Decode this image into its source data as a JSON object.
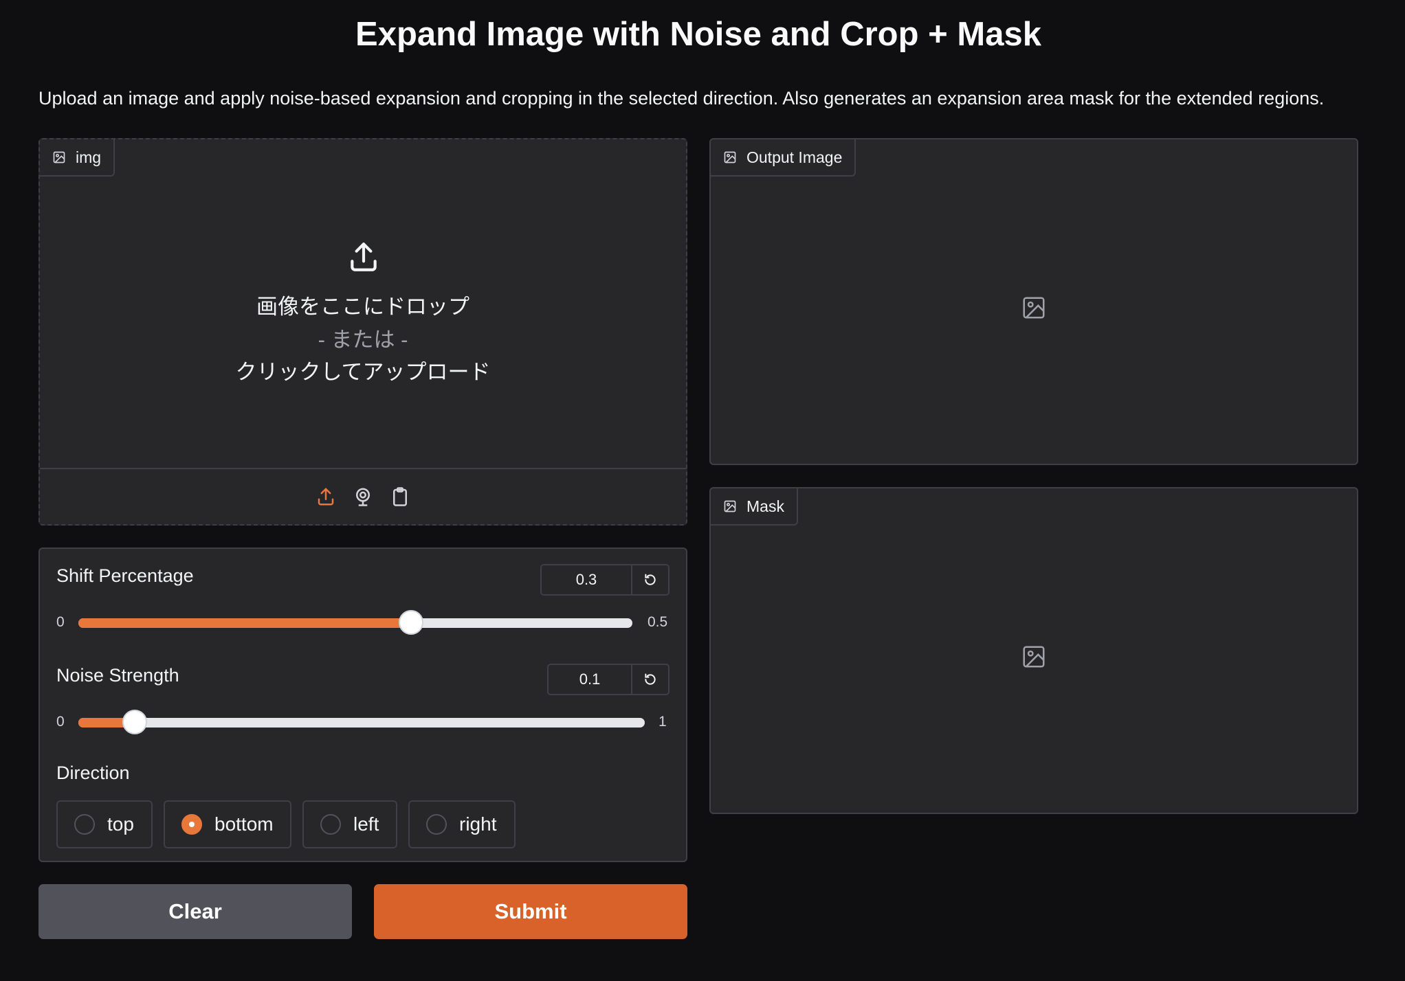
{
  "header": {
    "title": "Expand Image with Noise and Crop + Mask",
    "description": "Upload an image and apply noise-based expansion and cropping in the selected direction. Also generates an expansion area mask for the extended regions."
  },
  "input_image": {
    "label": "img",
    "drop_text": "画像をここにドロップ",
    "or_text": "- または -",
    "click_text": "クリックしてアップロード",
    "source_icons": [
      "upload-icon",
      "webcam-icon",
      "clipboard-icon"
    ]
  },
  "shift_percentage": {
    "label": "Shift Percentage",
    "value": "0.3",
    "min": "0",
    "max": "0.5"
  },
  "noise_strength": {
    "label": "Noise Strength",
    "value": "0.1",
    "min": "0",
    "max": "1"
  },
  "direction": {
    "label": "Direction",
    "options": [
      "top",
      "bottom",
      "left",
      "right"
    ],
    "selected": "bottom"
  },
  "buttons": {
    "clear": "Clear",
    "submit": "Submit"
  },
  "output_image": {
    "label": "Output Image"
  },
  "mask_image": {
    "label": "Mask"
  },
  "colors": {
    "accent": "#e8773c",
    "submit": "#d9622b",
    "clear": "#52525b",
    "panel": "#27272a",
    "background": "#0f0f11"
  }
}
